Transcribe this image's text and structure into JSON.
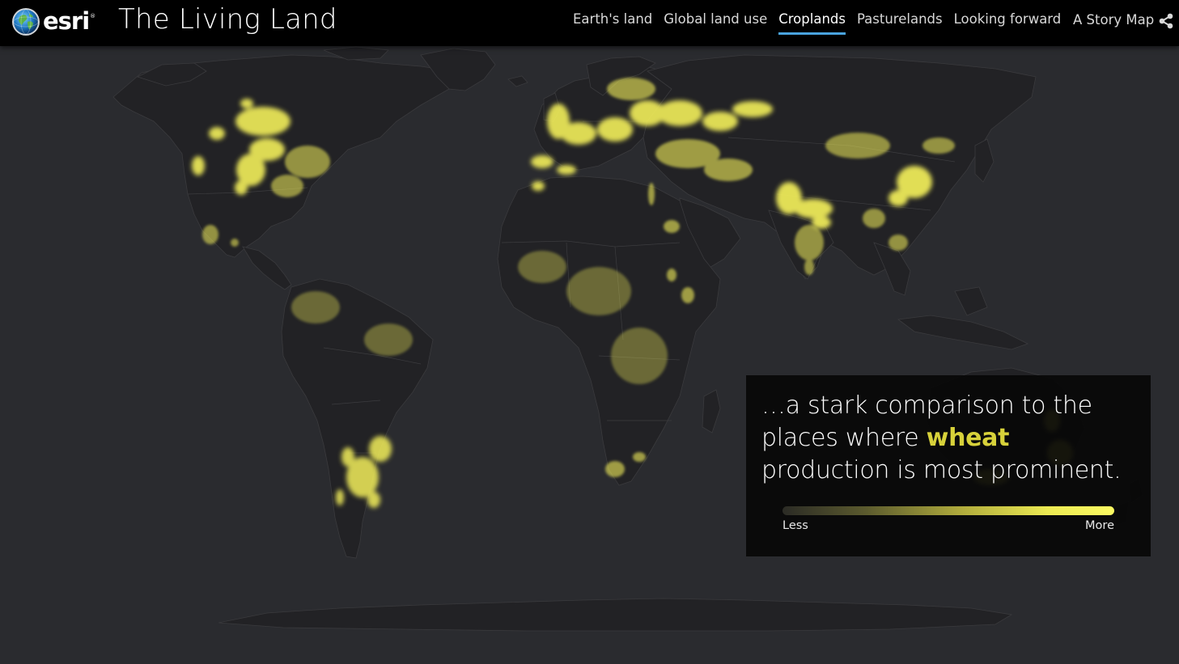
{
  "header": {
    "logo_text": "esri",
    "logo_tm": "®",
    "title": "The Living Land",
    "tabs": [
      {
        "label": "Earth's land",
        "active": false
      },
      {
        "label": "Global land use",
        "active": false
      },
      {
        "label": "Croplands",
        "active": true
      },
      {
        "label": "Pasturelands",
        "active": false
      },
      {
        "label": "Looking forward",
        "active": false
      }
    ],
    "story_map_label": "A Story Map",
    "share_icon": "share-icon"
  },
  "info_panel": {
    "text_before": "…a stark comparison to the places where ",
    "highlight": "wheat",
    "text_after": " production is most prominent.",
    "highlight_color": "#d7d13a",
    "legend": {
      "low_label": "Less",
      "high_label": "More",
      "gradient_colors": [
        "#2b2b25",
        "#5b5a2e",
        "#b3ae3d",
        "#ecea53",
        "#fbfa62"
      ]
    }
  },
  "map": {
    "basemap_color": "#2a2b2f",
    "land_color": "#222225",
    "intensity_color": "#f2ee5a",
    "layer": "wheat production intensity"
  },
  "colors": {
    "header_bg": "#000000",
    "active_tab_underline": "#4aa3df"
  }
}
